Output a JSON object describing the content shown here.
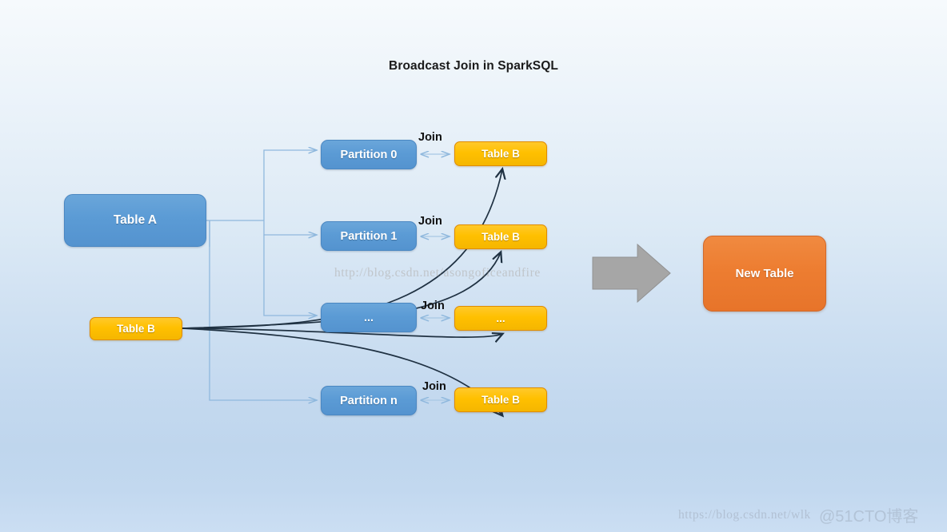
{
  "diagram": {
    "title": "Broadcast Join in SparkSQL",
    "source_table": {
      "label": "Table A"
    },
    "broadcast_table": {
      "label": "Table B"
    },
    "result_table": {
      "label": "New Table"
    },
    "rows": [
      {
        "partition": "Partition 0",
        "join_label": "Join",
        "broadcast_copy": "Table B"
      },
      {
        "partition": "Partition 1",
        "join_label": "Join",
        "broadcast_copy": "Table B"
      },
      {
        "partition": "...",
        "join_label": "Join",
        "broadcast_copy": "..."
      },
      {
        "partition": "Partition n",
        "join_label": "Join",
        "broadcast_copy": "Table B"
      }
    ],
    "colors": {
      "blue": "#5b9bd5",
      "yellow": "#ffc000",
      "orange": "#ed7d31",
      "gray_arrow": "#a6a6a6",
      "connector_blue": "#8fb8dd",
      "broadcast_curve": "#1f3142",
      "background_top": "#f6fafd",
      "background_bottom": "#cbdef3"
    }
  },
  "watermarks": {
    "center": "http://blog.csdn.net/asongoficeandfire",
    "bottom": "https://blog.csdn.net/wlk",
    "bottom_overlay": "@51CTO博客"
  }
}
